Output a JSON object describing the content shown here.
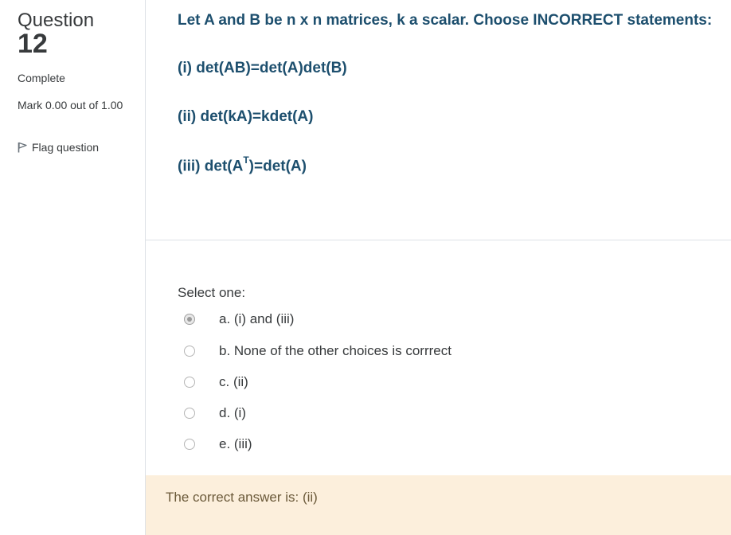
{
  "info": {
    "question_label": "Question",
    "question_number": "12",
    "state": "Complete",
    "grade": "Mark 0.00 out of 1.00",
    "flag_label": "Flag question"
  },
  "question": {
    "prompt": "Let A and B be n x n matrices, k a scalar. Choose INCORRECT statements:",
    "statement_1": "(i) det(AB)=det(A)det(B)",
    "statement_2": "(ii) det(kA)=kdet(A)",
    "statement_3_pre": "(iii) det(A",
    "statement_3_sup": "T",
    "statement_3_post": ")=det(A)"
  },
  "answer": {
    "select_prompt": "Select one:",
    "options": [
      {
        "label": "a. (i) and (iii)",
        "selected": true
      },
      {
        "label": "b. None of the other choices is corrrect",
        "selected": false
      },
      {
        "label": "c. (ii)",
        "selected": false
      },
      {
        "label": "d. (i)",
        "selected": false
      },
      {
        "label": "e. (iii)",
        "selected": false
      }
    ]
  },
  "feedback": {
    "text": "The correct answer is: (ii)"
  }
}
